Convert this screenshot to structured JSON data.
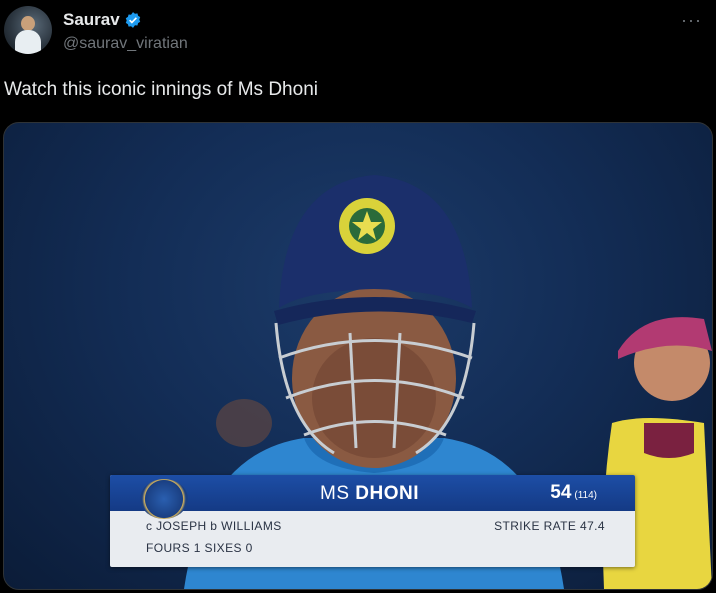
{
  "author": {
    "display_name": "Saurav",
    "handle": "@saurav_viratian",
    "verified_icon": "verified-badge-icon",
    "avatar_icon": "avatar-photo"
  },
  "more_menu": {
    "label": "···"
  },
  "tweet": {
    "text": "Watch this iconic innings of Ms Dhoni"
  },
  "media": {
    "scorecard": {
      "player_first": "MS ",
      "player_last": "DHONI",
      "runs": "54",
      "balls": "(114)",
      "dismissal": "c JOSEPH b WILLIAMS",
      "strike_rate": "STRIKE RATE 47.4",
      "boundaries": "FOURS 1  SIXES 0"
    }
  },
  "colors": {
    "background": "#000000",
    "text": "#e7e9ea",
    "secondary_text": "#71767b",
    "verified": "#1d9bf0",
    "helmet_blue": "#1b2f6b"
  }
}
